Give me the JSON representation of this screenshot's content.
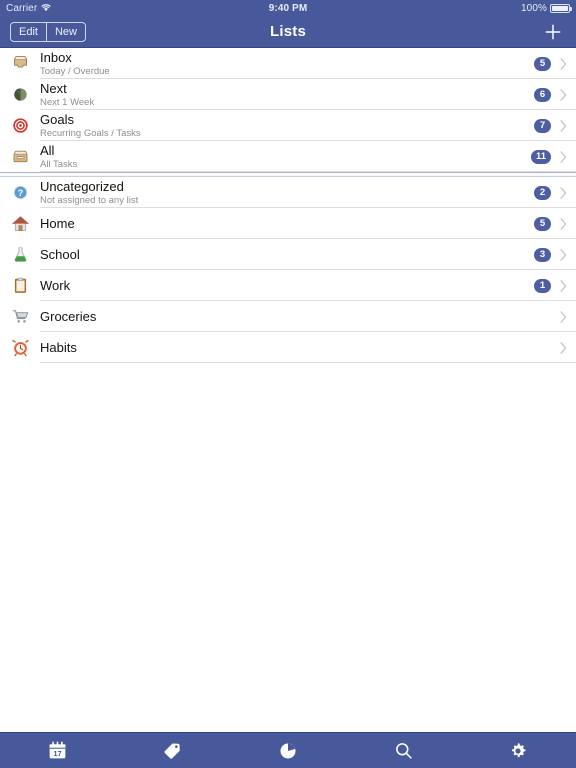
{
  "status_bar": {
    "carrier": "Carrier",
    "wifi_icon": "wifi-icon",
    "time": "9:40 PM",
    "battery_percent": "100%",
    "battery_icon": "battery-full-icon"
  },
  "nav_bar": {
    "title": "Lists",
    "edit_label": "Edit",
    "new_label": "New",
    "add_icon": "plus-icon",
    "background_color": "#47589b"
  },
  "theme": {
    "accent": "#47589b",
    "badge_color": "#4d5fa0",
    "separator": "#dedede",
    "subtitle_color": "#8e8e93"
  },
  "groups": [
    {
      "name": "smart-lists",
      "rows": [
        {
          "title": "Inbox",
          "subtitle": "Today / Overdue",
          "badge": "5",
          "icon": "inbox-tray-icon"
        },
        {
          "title": "Next",
          "subtitle": "Next 1 Week",
          "badge": "6",
          "icon": "moon-phase-icon"
        },
        {
          "title": "Goals",
          "subtitle": "Recurring Goals / Tasks",
          "badge": "7",
          "icon": "target-icon"
        },
        {
          "title": "All",
          "subtitle": "All Tasks",
          "badge": "11",
          "icon": "file-box-icon"
        }
      ]
    },
    {
      "name": "user-lists",
      "rows": [
        {
          "title": "Uncategorized",
          "subtitle": "Not assigned to any list",
          "badge": "2",
          "icon": "question-mark-icon"
        },
        {
          "title": "Home",
          "subtitle": "",
          "badge": "5",
          "icon": "house-icon"
        },
        {
          "title": "School",
          "subtitle": "",
          "badge": "3",
          "icon": "flask-icon"
        },
        {
          "title": "Work",
          "subtitle": "",
          "badge": "1",
          "icon": "clipboard-icon"
        },
        {
          "title": "Groceries",
          "subtitle": "",
          "badge": "",
          "icon": "shopping-cart-icon"
        },
        {
          "title": "Habits",
          "subtitle": "",
          "badge": "",
          "icon": "alarm-clock-icon"
        }
      ]
    }
  ],
  "tab_bar": {
    "items": [
      {
        "name": "calendar",
        "icon": "calendar-icon",
        "day": "17"
      },
      {
        "name": "tags",
        "icon": "tag-icon"
      },
      {
        "name": "stats",
        "icon": "pie-chart-icon"
      },
      {
        "name": "search",
        "icon": "search-icon"
      },
      {
        "name": "settings",
        "icon": "gear-icon"
      }
    ]
  }
}
